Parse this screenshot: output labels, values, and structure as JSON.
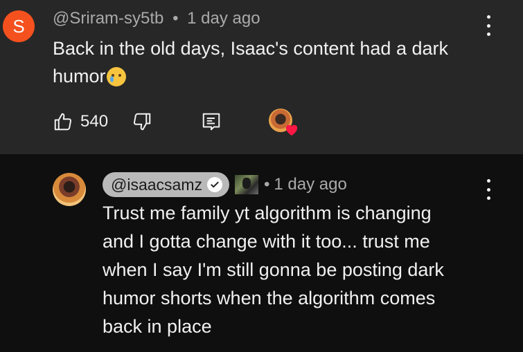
{
  "comment": {
    "avatar_letter": "S",
    "avatar_color": "#f4511e",
    "author": "@Sriram-sy5tb",
    "separator": "•",
    "time": "1 day ago",
    "text": "Back in the old days, Isaac's content had a dark humor",
    "emoji_icon": "crying-face-emoji",
    "likes": "540",
    "actions": {
      "like_icon": "thumbs-up-icon",
      "dislike_icon": "thumbs-down-icon",
      "reply_icon": "reply-comment-icon",
      "creator_heart_icon": "creator-heart-icon",
      "heart_color": "#ff1744"
    },
    "menu_icon": "more-vert-icon"
  },
  "reply": {
    "author": "@isaacsamz",
    "verified_icon": "verified-check-icon",
    "separator": "•",
    "time": "1 day ago",
    "lines": [
      "Trust me family yt algorithm is changing",
      "and I gotta change with it too... trust me",
      "when I say I'm still gonna be posting dark",
      "humor shorts when the algorithm comes",
      "back in place"
    ],
    "menu_icon": "more-vert-icon"
  },
  "colors": {
    "comment_bg": "#272727",
    "reply_bg": "#0f0f0f",
    "pill_bg": "#b9b9b9",
    "meta_text": "#aaaaaa"
  }
}
